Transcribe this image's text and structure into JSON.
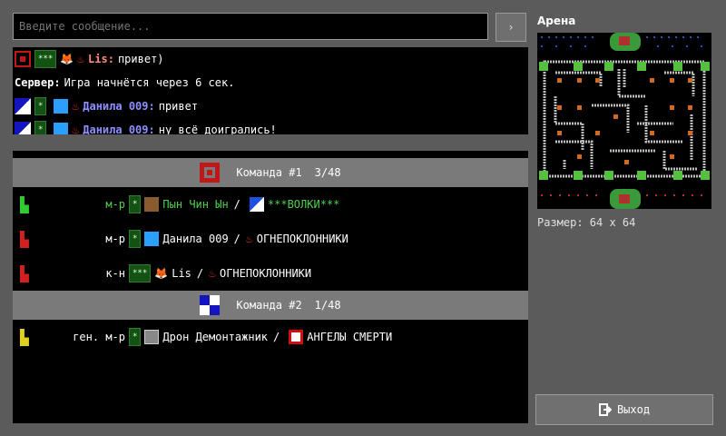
{
  "chat": {
    "placeholder": "Введите сообщение...",
    "send_label": "›",
    "messages": [
      {
        "nick": "Lis:",
        "text": "привет)",
        "rank": "***"
      },
      {
        "server_label": "Сервер:",
        "text": "Игра начнётся через 6 сек."
      },
      {
        "nick": "Данила 009:",
        "text": "привет",
        "rank": "*"
      },
      {
        "nick": "Данила 009:",
        "text": "ну всё доигрались!",
        "rank": "*"
      }
    ]
  },
  "teams": [
    {
      "title": "Команда #1",
      "count": "3/48",
      "color": "#c01818",
      "players": [
        {
          "rank": "м-р",
          "rank_stars": "*",
          "name": "Пын Чин Ын",
          "clan": "***ВОЛКИ***",
          "tank_color": "#2ecc2e",
          "name_color": "#4fcf4f"
        },
        {
          "rank": "м-р",
          "rank_stars": "*",
          "name": "Данила 009",
          "clan": "ОГНЕПОКЛОННИКИ",
          "tank_color": "#d02020",
          "name_color": "#ffffff"
        },
        {
          "rank": "к-н",
          "rank_stars": "***",
          "name": "Lis",
          "clan": "ОГНЕПОКЛОННИКИ",
          "tank_color": "#d02020",
          "name_color": "#ffffff"
        }
      ]
    },
    {
      "title": "Команда #2",
      "count": "1/48",
      "color": "#1515c0",
      "players": [
        {
          "rank": "ген. м-р",
          "rank_stars": "*",
          "name": "Дрон Демонтажник",
          "clan": "АНГЕЛЫ СМЕРТИ",
          "tank_color": "#e0d020",
          "name_color": "#ffffff"
        }
      ]
    }
  ],
  "arena": {
    "title": "Арена",
    "size": "Размер: 64 x 64"
  },
  "exit_label": "Выход",
  "icons": {
    "tank": "tank-icon",
    "flame": "flame-icon",
    "exit": "exit-door-icon"
  }
}
